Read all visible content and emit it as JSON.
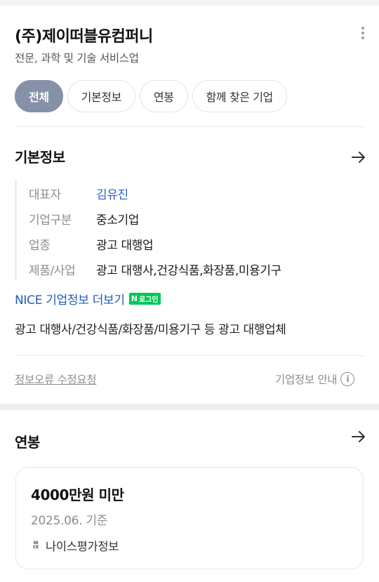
{
  "company": {
    "name": "(주)제이떠블유컴퍼니",
    "industry": "전문, 과학 및 기술 서비스업"
  },
  "tabs": [
    {
      "label": "전체",
      "active": true
    },
    {
      "label": "기본정보",
      "active": false
    },
    {
      "label": "연봉",
      "active": false
    },
    {
      "label": "함께 찾은 기업",
      "active": false
    }
  ],
  "basic_info": {
    "title": "기본정보",
    "rows": [
      {
        "label": "대표자",
        "value": "김유진"
      },
      {
        "label": "기업구분",
        "value": "중소기업"
      },
      {
        "label": "업종",
        "value": "광고 대행업"
      },
      {
        "label": "제품/사업",
        "value": "광고 대행사,건강식품,화장품,미용기구"
      }
    ],
    "nice_link": "NICE 기업정보 더보기",
    "login_badge": {
      "logo": "N",
      "label": "로그인"
    },
    "description": "광고 대행사/건강식품/화장품/미용기구 등 광고 대행업체",
    "report_link": "정보오류 수정요청",
    "guide_label": "기업정보 안내"
  },
  "salary": {
    "title": "연봉",
    "amount": "4000만원 미만",
    "date": "2025.06. 기준",
    "logo_text": [
      "NI",
      "CE"
    ],
    "source": "나이스평가정보"
  },
  "colors": {
    "active_tab": "#8691a8",
    "link_blue": "#2864c8",
    "naver_green": "#03c75a"
  },
  "icons": {
    "more": "more-vertical-icon",
    "arrow": "arrow-right-icon",
    "info": "info-circle-icon"
  }
}
